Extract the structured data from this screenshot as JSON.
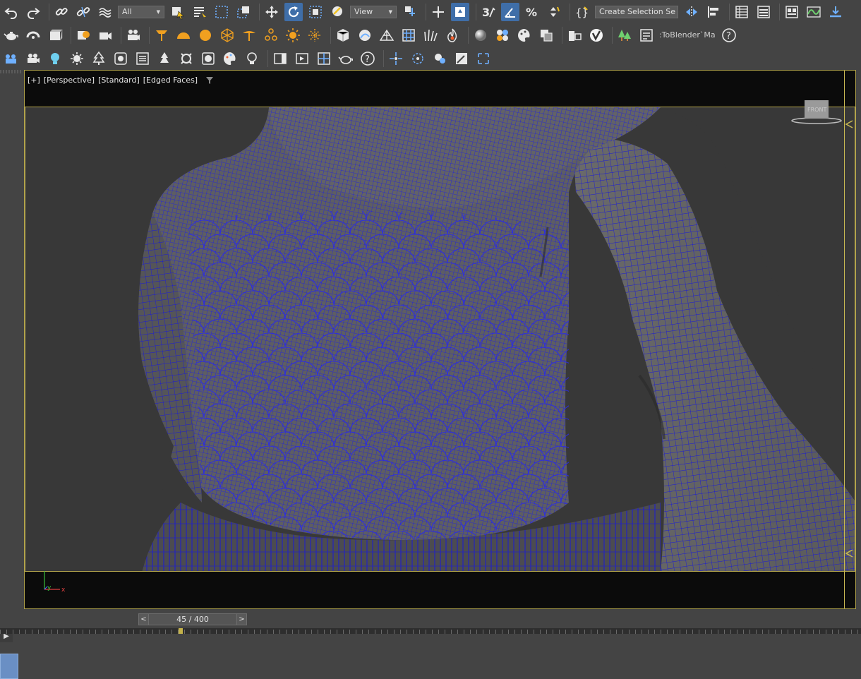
{
  "toolbar": {
    "row1": {
      "selection_filter": "All",
      "reference_coord": "View",
      "named_selection": "Create Selection Se",
      "icons": [
        "undo-icon",
        "redo-icon",
        "link-icon",
        "unlink-icon",
        "bind-space-warp-icon",
        "select-object-icon",
        "select-by-name-icon",
        "rect-region-icon",
        "window-crossing-icon",
        "move-icon",
        "rotate-icon",
        "scale-icon",
        "place-icon",
        "pivot-icon",
        "snaps-3d-icon",
        "angle-snap-icon",
        "percent-snap-icon",
        "spinner-snap-icon",
        "edit-named-sets-icon",
        "mirror-icon",
        "align-icon",
        "scene-explorer-icon",
        "layer-explorer-icon",
        "ribbon-icon",
        "curve-editor-icon",
        "render-to-texture-icon"
      ]
    },
    "row2": {
      "toblender_label": ":ToBlender`Ma",
      "help": "?"
    },
    "row3": {
      "help": "?"
    }
  },
  "viewport": {
    "label_plus": "[+]",
    "label_view": "[Perspective]",
    "label_shading": "[Standard]",
    "label_mode": "[Edged Faces]",
    "viewcube_text": "FRONT",
    "axis_y": "y",
    "axis_x": "x",
    "colors": {
      "wire": "#1a1ad6",
      "mesh": "#686868",
      "frame": "#b8a94e"
    }
  },
  "timeslider": {
    "prev": "<",
    "position": "45 / 400",
    "next": ">"
  }
}
